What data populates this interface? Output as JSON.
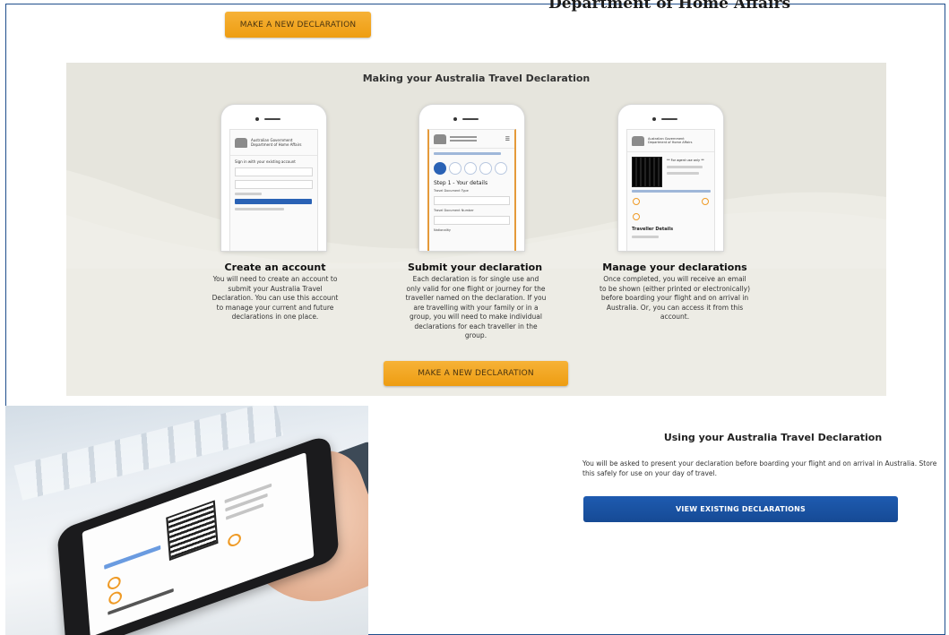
{
  "header": {
    "department": "Department of Home Affairs",
    "new_declaration_button": "MAKE A NEW DECLARATION"
  },
  "steps_section": {
    "title": "Making your Australia Travel Declaration",
    "steps": [
      {
        "heading": "Create an account",
        "description": "You will need to create an account to submit your Australia Travel Declaration. You can use this account to manage your current and future declarations in one place.",
        "screen": {
          "gov_name": "Australian Government",
          "dept_name": "Department of Home Affairs",
          "sign_in_text": "Sign in with your existing account"
        }
      },
      {
        "heading": "Submit your declaration",
        "description": "Each declaration is for single use and only valid for one flight or journey for the traveller named on the declaration. If you are travelling with your family or in a group, you will need to make individual declarations for each traveller in the group.",
        "screen": {
          "step_label": "Step 1 - Your details",
          "field_1": "Travel Document Type",
          "field_2": "Travel Document Number",
          "field_3": "Nationality"
        }
      },
      {
        "heading": "Manage your declarations",
        "description": "Once completed, you will receive an email to be shown (either printed or electronically) before boarding your flight and on arrival in Australia. Or, you can access it from this account.",
        "screen": {
          "gov_name": "Australian Government",
          "dept_name": "Department of Home Affairs",
          "agent_note": "** For agent use only **",
          "section_label": "Traveller Details"
        }
      }
    ],
    "new_declaration_button": "MAKE A NEW DECLARATION"
  },
  "using_section": {
    "title": "Using your Australia Travel Declaration",
    "description": "You will be asked to present your declaration before boarding your flight and on arrival in Australia. Store this safely for use on your day of travel.",
    "view_button": "VIEW EXISTING DECLARATIONS"
  },
  "colors": {
    "accent_orange": "#f2a527",
    "primary_blue": "#1a55a6",
    "panel_bg": "#edece5"
  }
}
